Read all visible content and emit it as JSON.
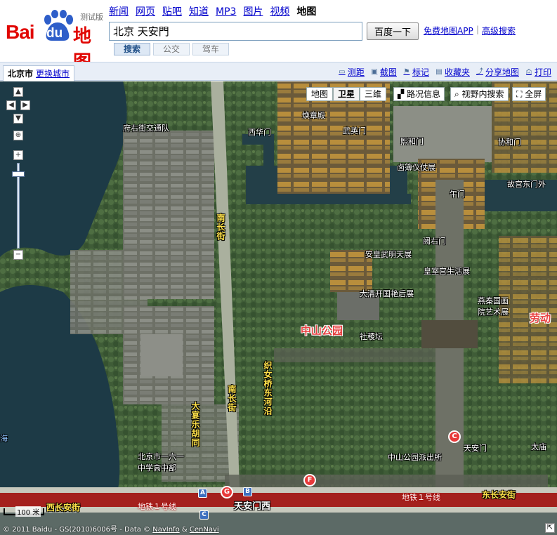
{
  "logo": {
    "bai": "Bai",
    "du": "du",
    "ditu": "地图",
    "beta": "测试版"
  },
  "nav": [
    {
      "label": "新闻"
    },
    {
      "label": "网页"
    },
    {
      "label": "贴吧"
    },
    {
      "label": "知道"
    },
    {
      "label": "MP3"
    },
    {
      "label": "图片"
    },
    {
      "label": "视频"
    },
    {
      "label": "地图",
      "current": true
    }
  ],
  "search": {
    "value": "北京 天安門",
    "button": "百度一下"
  },
  "links": {
    "app": "免费地图APP",
    "sep": "|",
    "advanced": "高级搜索"
  },
  "modes": [
    {
      "label": "搜索",
      "active": true
    },
    {
      "label": "公交"
    },
    {
      "label": "驾车"
    }
  ],
  "toolbar": {
    "city": "北京市",
    "change_city": "更换城市",
    "tools": [
      {
        "label": "测距",
        "icon": "ruler-icon"
      },
      {
        "label": "截图",
        "icon": "screenshot-icon"
      },
      {
        "label": "标记",
        "icon": "marker-icon"
      },
      {
        "label": "收藏夹",
        "icon": "folder-icon"
      },
      {
        "label": "分享地图",
        "icon": "share-icon"
      },
      {
        "label": "打印",
        "icon": "print-icon"
      }
    ]
  },
  "map": {
    "types": [
      {
        "label": "地图"
      },
      {
        "label": "卫星",
        "active": true
      },
      {
        "label": "三维"
      }
    ],
    "traffic": "路况信息",
    "view_search": "视野内搜索",
    "fullscreen": "全屏",
    "labels": {
      "fuyoujie": "府右街交通队",
      "xihuamen": "西华门",
      "wuyingmen": "武英门",
      "zhuandian": "焕章殿",
      "xihemen": "熙和门",
      "xiehemen": "协和门",
      "yiyizhan": "卤簿仪仗展",
      "wumen": "午门",
      "gugong_east": "故宫东门外",
      "queyoumen": "阙右门",
      "nanchangjie1": "南长街",
      "nanchangjie2": "南长街",
      "xiwu": "安皇武明天展",
      "huangshi": "皇室宫生活展",
      "taiji": "大清开国艳后展",
      "yanqin": "燕秦国画院艺术展",
      "laodong": "劳动",
      "zhongshan": "中山公园",
      "sheji": "社稷坛",
      "zhinv": "织女桥东河沿",
      "dajiangfang": "大宴乐胡同",
      "school": "北京市一六一中学高中部",
      "police": "中山公园派出所",
      "tiananmen": "天安门",
      "taimiao": "太庙",
      "xichangan": "西长安街",
      "metro1": "地铁１号线",
      "metro2": "地铁１号线",
      "dongchangan": "东长安街",
      "tiananmenxi": "天安门西",
      "hai": "海"
    },
    "markers": {
      "c": "C",
      "g": "G",
      "f": "F",
      "a": "A",
      "b": "B",
      "cc": "C"
    },
    "scale": "100 米",
    "copyright": {
      "prefix": "© 2011 Baidu - GS(2010)6006号 - Data ©",
      "navinfo": "NavInfo",
      "amp": "&",
      "cennavi": "CenNavi"
    }
  }
}
